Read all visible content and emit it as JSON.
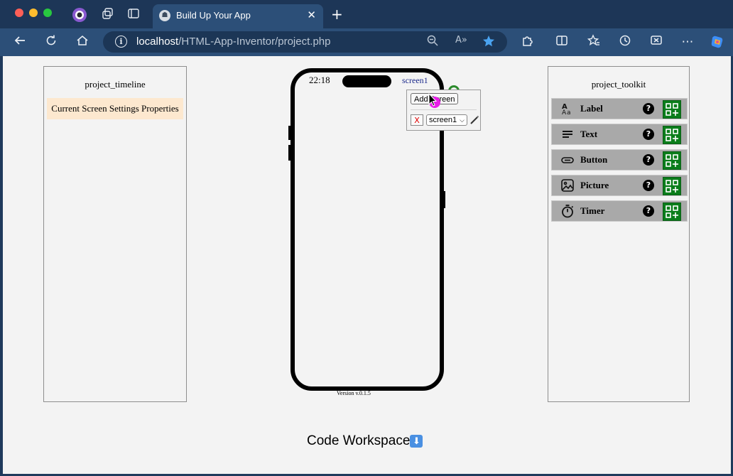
{
  "browser": {
    "tab_title": "Build Up Your App",
    "tab_close": "✕",
    "new_tab": "+",
    "url_host": "localhost",
    "url_path": "/HTML-App-Inventor/project.php"
  },
  "timeline": {
    "title": "project_timeline",
    "items": [
      "Current Screen Settings Properties"
    ]
  },
  "phone": {
    "time": "22:18",
    "screen_name": "screen1",
    "version": "Version v.0.1.5"
  },
  "popup": {
    "add_screen_label": "Add Screen",
    "delete_label": "X",
    "selected_screen": "screen1"
  },
  "toolkit": {
    "title": "project_toolkit",
    "tools": [
      {
        "label": "Label",
        "icon": "label-icon"
      },
      {
        "label": "Text",
        "icon": "text-icon"
      },
      {
        "label": "Button",
        "icon": "button-icon"
      },
      {
        "label": "Picture",
        "icon": "picture-icon"
      },
      {
        "label": "Timer",
        "icon": "timer-icon"
      }
    ],
    "help": "?"
  },
  "workspace": {
    "label": "Code Workspace"
  },
  "colors": {
    "titlebar": "#1d3657",
    "toolbar": "#2c4f78",
    "tool_bg": "#a9a9a9",
    "add_green": "#0a7d1a",
    "timeline_item_bg": "#fde8cf"
  }
}
